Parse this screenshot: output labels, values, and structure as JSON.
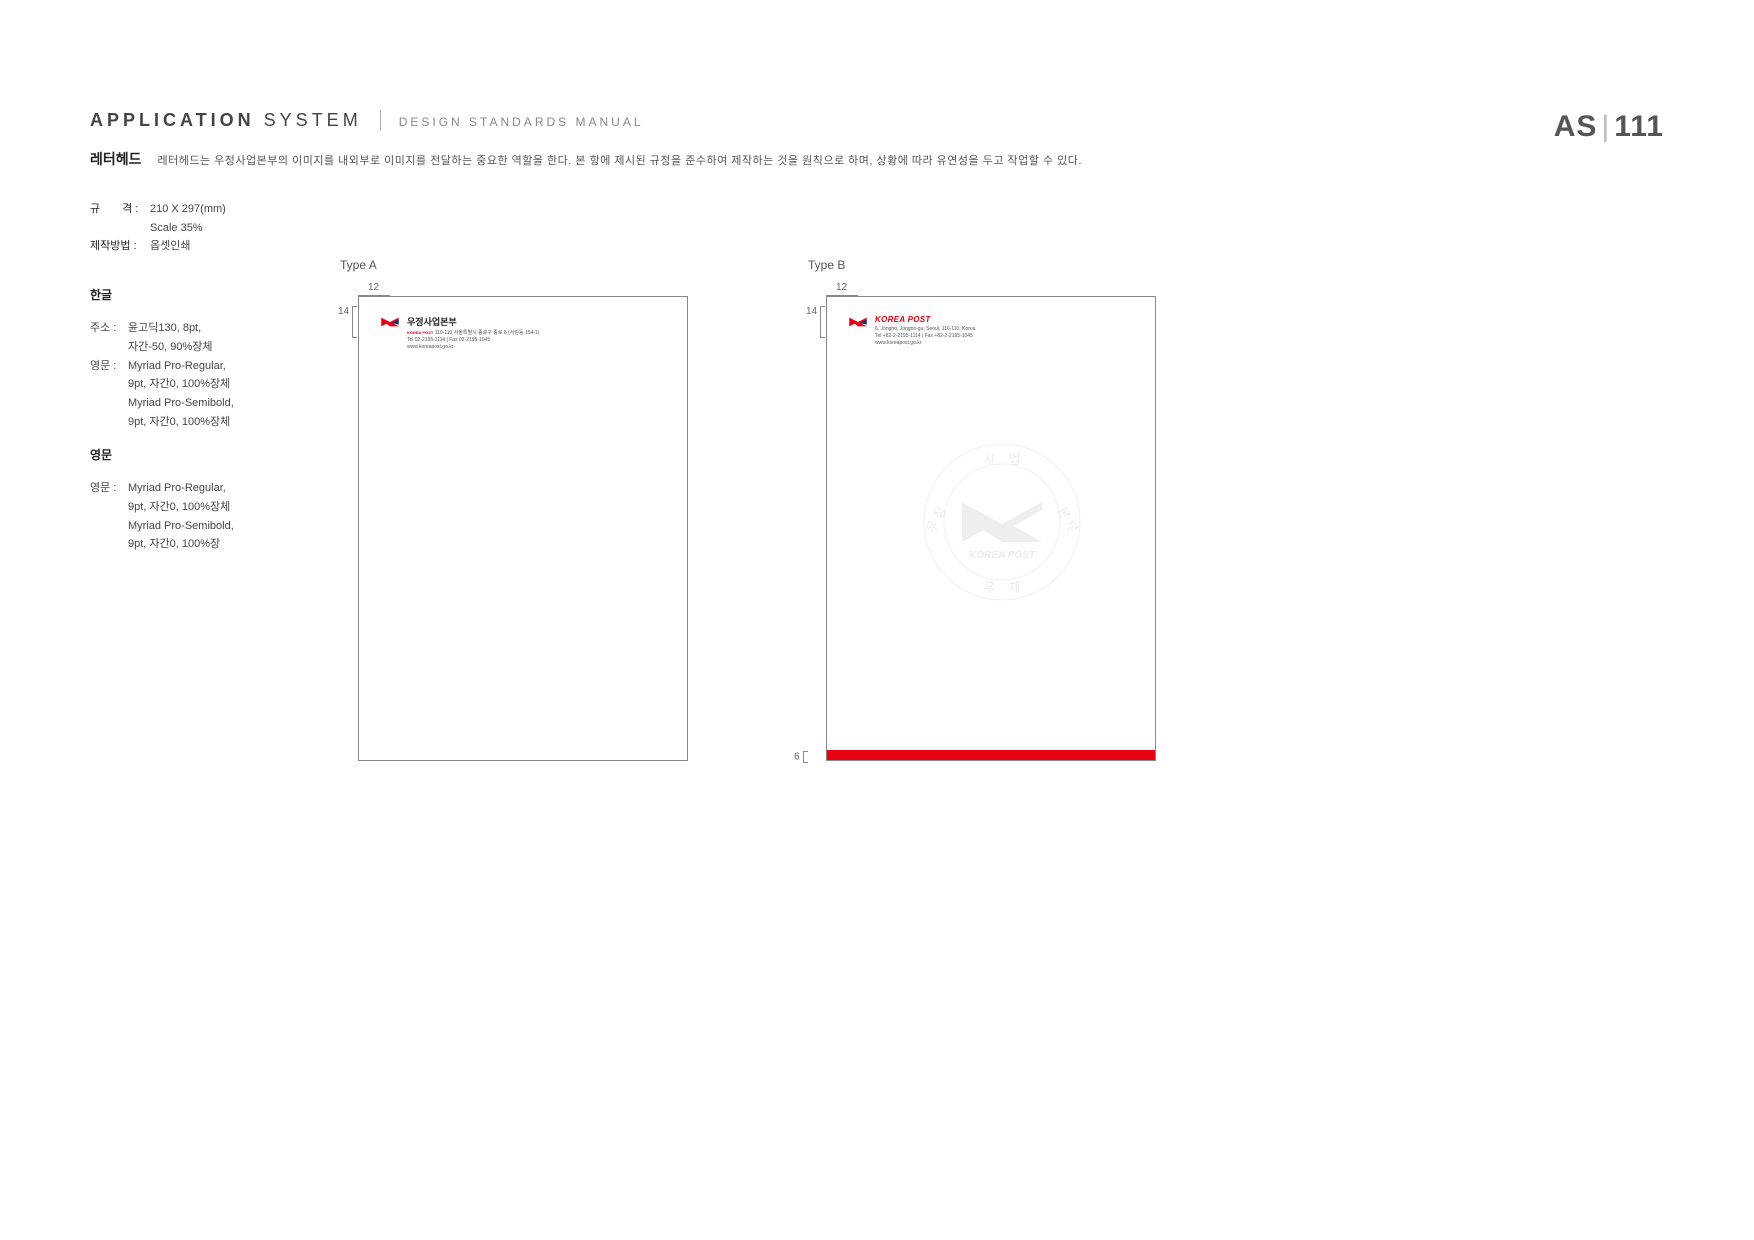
{
  "header": {
    "app_bold": "APPLICATION",
    "app_light": " SYSTEM",
    "manual": "DESIGN STANDARDS MANUAL",
    "code_prefix": "AS",
    "code_num": "111"
  },
  "title": {
    "name": "레터헤드",
    "desc": "레터헤드는 우정사업본부의 이미지를 내외부로 이미지를 전달하는 중요한 역할을 한다. 본 항에 제시된 규정을 준수하여 제작하는 것을 원칙으로 하며, 상황에 따라 유연성을 두고 작업할 수 있다."
  },
  "specs": {
    "size_label": "규　　격 :",
    "size_value": "210 X 297(mm)",
    "scale": "Scale 35%",
    "method_label": "제작방법 :",
    "method_value": "옵셋인쇄"
  },
  "typo_ko": {
    "heading": "한글",
    "addr_label": "주소 :",
    "addr_l1": "윤고딕130, 8pt,",
    "addr_l2": "자간-50, 90%장체",
    "eng_label": "영문 :",
    "eng_l1": "Myriad Pro-Regular,",
    "eng_l2": "9pt, 자간0, 100%장체",
    "eng_l3": "Myriad Pro-Semibold,",
    "eng_l4": "9pt, 자간0, 100%장체"
  },
  "typo_en": {
    "heading": "영문",
    "eng_label": "영문 :",
    "eng_l1": "Myriad Pro-Regular,",
    "eng_l2": "9pt, 자간0, 100%장체",
    "eng_l3": "Myriad Pro-Semibold,",
    "eng_l4": "9pt, 자간0, 100%장"
  },
  "samples": {
    "a": {
      "label": "Type A",
      "dim_top": "12",
      "dim_left": "14",
      "logo_name": "우정사업본부",
      "logo_sub": "KOREA POST",
      "addr1": "110-110 서울특별시 종로구 종로 6 (서린동 154-1)",
      "addr2": "Tel 02-2195-1114 | Fax 02-2195-1045",
      "addr3": "www.koreapost.go.kr"
    },
    "b": {
      "label": "Type B",
      "dim_top": "12",
      "dim_left": "14",
      "dim_bottom": "6",
      "logo_name": "KOREA POST",
      "addr1": "6, Jongno, Jongno-gu, Seoul, 110-110, Korea",
      "addr2": "Tel +82-2-2195-1114 | Fax +82-2-2195-1045",
      "addr3": "www.koreapost.go.kr",
      "watermark_top": "사 업",
      "watermark_left": "우 정",
      "watermark_right": "본 부",
      "watermark_bottom_en": "KOREA POST",
      "watermark_bottom": "우　체"
    }
  }
}
